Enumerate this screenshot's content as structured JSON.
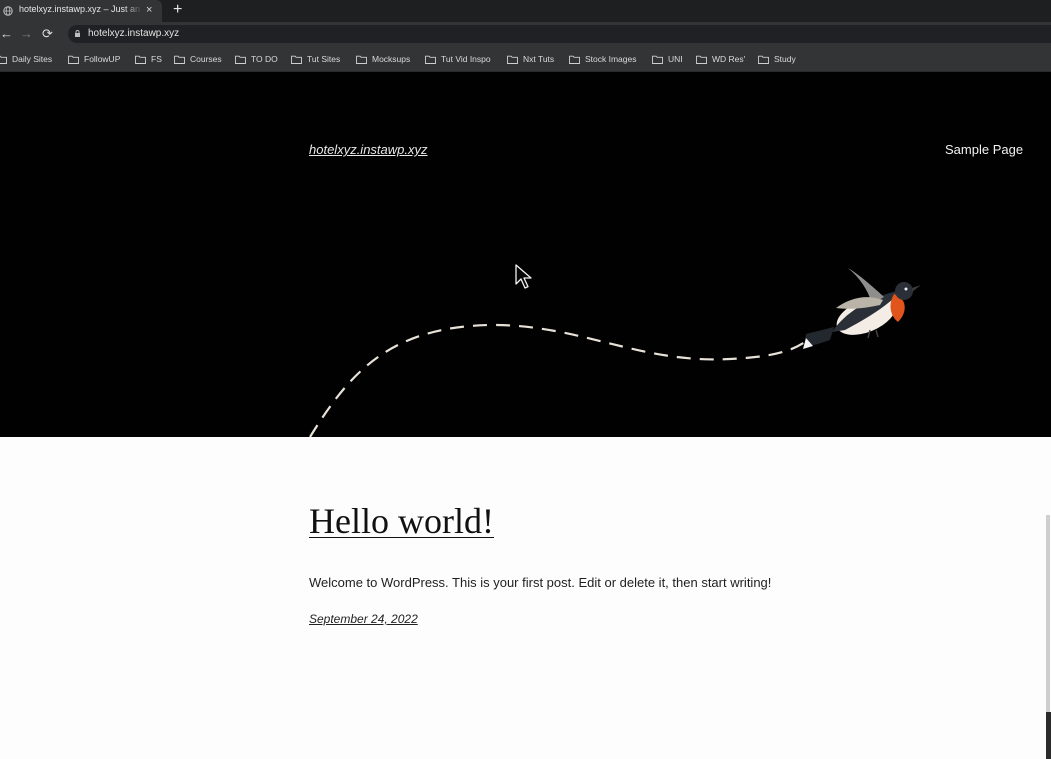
{
  "browser": {
    "tab": {
      "title": "hotelxyz.instawp.xyz – Just an",
      "close_icon": "×",
      "new_tab_icon": "+"
    },
    "nav": {
      "back_icon": "←",
      "forward_icon": "→",
      "reload_icon": "⟳"
    },
    "address_bar": {
      "url": "hotelxyz.instawp.xyz"
    },
    "bookmarks": [
      {
        "label": "Daily Sites"
      },
      {
        "label": "FollowUP"
      },
      {
        "label": "FS"
      },
      {
        "label": "Courses"
      },
      {
        "label": "TO DO"
      },
      {
        "label": "Tut Sites"
      },
      {
        "label": "Mocksups"
      },
      {
        "label": "Tut Vid Inspo"
      },
      {
        "label": "Nxt Tuts"
      },
      {
        "label": "Stock Images"
      },
      {
        "label": "UNI"
      },
      {
        "label": "WD Res'"
      },
      {
        "label": "Study"
      }
    ]
  },
  "site": {
    "title": "hotelxyz.instawp.xyz",
    "nav": {
      "sample_page": "Sample Page"
    },
    "colors": {
      "header_bg": "#010101",
      "page_bg": "#fdfdfd",
      "bird_breast": "#e1541c"
    }
  },
  "post": {
    "title": "Hello world!",
    "excerpt": "Welcome to WordPress. This is your first post. Edit or delete it, then start writing!",
    "date": "September 24, 2022"
  }
}
